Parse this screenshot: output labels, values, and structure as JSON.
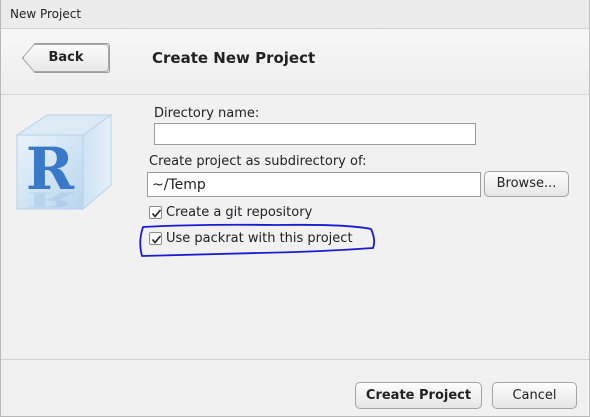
{
  "window": {
    "title": "New Project"
  },
  "header": {
    "back_label": "Back",
    "title": "Create New Project"
  },
  "form": {
    "directory_name_label": "Directory name:",
    "directory_name_value": "",
    "subdirectory_label": "Create project as subdirectory of:",
    "subdirectory_value": "~/Temp",
    "browse_label": "Browse...",
    "git_label": "Create a git repository",
    "git_checked": true,
    "packrat_label": "Use packrat with this project",
    "packrat_checked": true
  },
  "footer": {
    "create_label": "Create Project",
    "cancel_label": "Cancel"
  },
  "icons": {
    "logo": "r-cube-logo",
    "check": "checkmark-icon"
  },
  "colors": {
    "annotation": "#1a1ad4",
    "logo_blue": "#3a78c8"
  }
}
